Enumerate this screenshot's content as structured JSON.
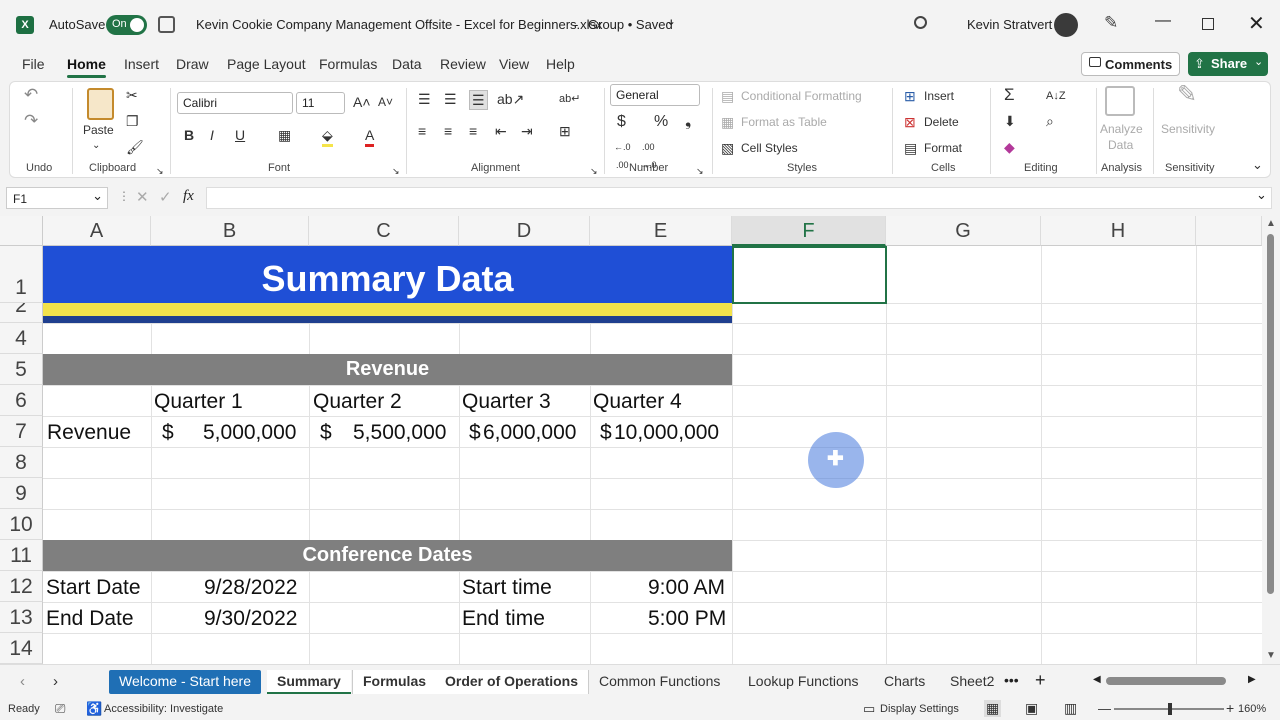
{
  "titlebar": {
    "app_icon": "excel-logo",
    "autosave_label": "AutoSave",
    "autosave_state": "On",
    "doc_title": "Kevin Cookie Company Management Offsite - Excel for Beginners.xlsx",
    "separator": "-",
    "group_saved": "Group • Saved",
    "user_name": "Kevin Stratvert",
    "accent": "#217346"
  },
  "ribbon_tabs": [
    "File",
    "Home",
    "Insert",
    "Draw",
    "Page Layout",
    "Formulas",
    "Data",
    "Review",
    "View",
    "Help"
  ],
  "ribbon_right": {
    "comments": "Comments",
    "share": "Share"
  },
  "ribbon": {
    "undo_label": "Undo",
    "clipboard_label": "Clipboard",
    "paste": "Paste",
    "font_label": "Font",
    "font_name": "Calibri",
    "font_size": "11",
    "alignment_label": "Alignment",
    "number_label": "Number",
    "number_format": "General",
    "styles_label": "Styles",
    "conditional_formatting": "Conditional Formatting",
    "format_as_table": "Format as Table",
    "cell_styles": "Cell Styles",
    "cells_label": "Cells",
    "insert": "Insert",
    "delete": "Delete",
    "format": "Format",
    "editing_label": "Editing",
    "analyze_data_1": "Analyze",
    "analyze_data_2": "Data",
    "analysis_label": "Analysis",
    "sensitivity_top": "Sensitivity",
    "sensitivity_label": "Sensitivity"
  },
  "formula_bar": {
    "name_box": "F1",
    "fx": "fx",
    "value": ""
  },
  "columns": [
    "A",
    "B",
    "C",
    "D",
    "E",
    "F",
    "G",
    "H"
  ],
  "rows": [
    "1",
    "2",
    "4",
    "5",
    "6",
    "7",
    "8",
    "9",
    "10",
    "11",
    "12",
    "13",
    "14"
  ],
  "sheet": {
    "title": "Summary Data",
    "revenue_header": "Revenue",
    "quarters": [
      "Quarter 1",
      "Quarter 2",
      "Quarter 3",
      "Quarter 4"
    ],
    "revenue_label": "Revenue",
    "revenue_values": [
      {
        "sym": "$",
        "num": "5,000,000"
      },
      {
        "sym": "$",
        "num": "5,500,000"
      },
      {
        "sym": "$",
        "num": "6,000,000"
      },
      {
        "sym": "$",
        "num": "10,000,000"
      }
    ],
    "conference_header": "Conference Dates",
    "start_date_label": "Start Date",
    "start_date": "9/28/2022",
    "start_time_label": "Start time",
    "start_time": "9:00 AM",
    "end_date_label": "End Date",
    "end_date": "9/30/2022",
    "end_time_label": "End time",
    "end_time": "5:00 PM",
    "title_bg": "#1f4fd6",
    "stripe_yellow": "#f2e24b",
    "stripe_blue": "#1f3f8f",
    "section_bg": "#7f7f7f"
  },
  "sheet_tabs": [
    "Welcome - Start here",
    "Summary",
    "Formulas",
    "Order of Operations",
    "Common Functions",
    "Lookup Functions",
    "Charts",
    "Sheet2"
  ],
  "status": {
    "ready": "Ready",
    "accessibility": "Accessibility: Investigate",
    "display_settings": "Display Settings",
    "zoom": "160%"
  }
}
